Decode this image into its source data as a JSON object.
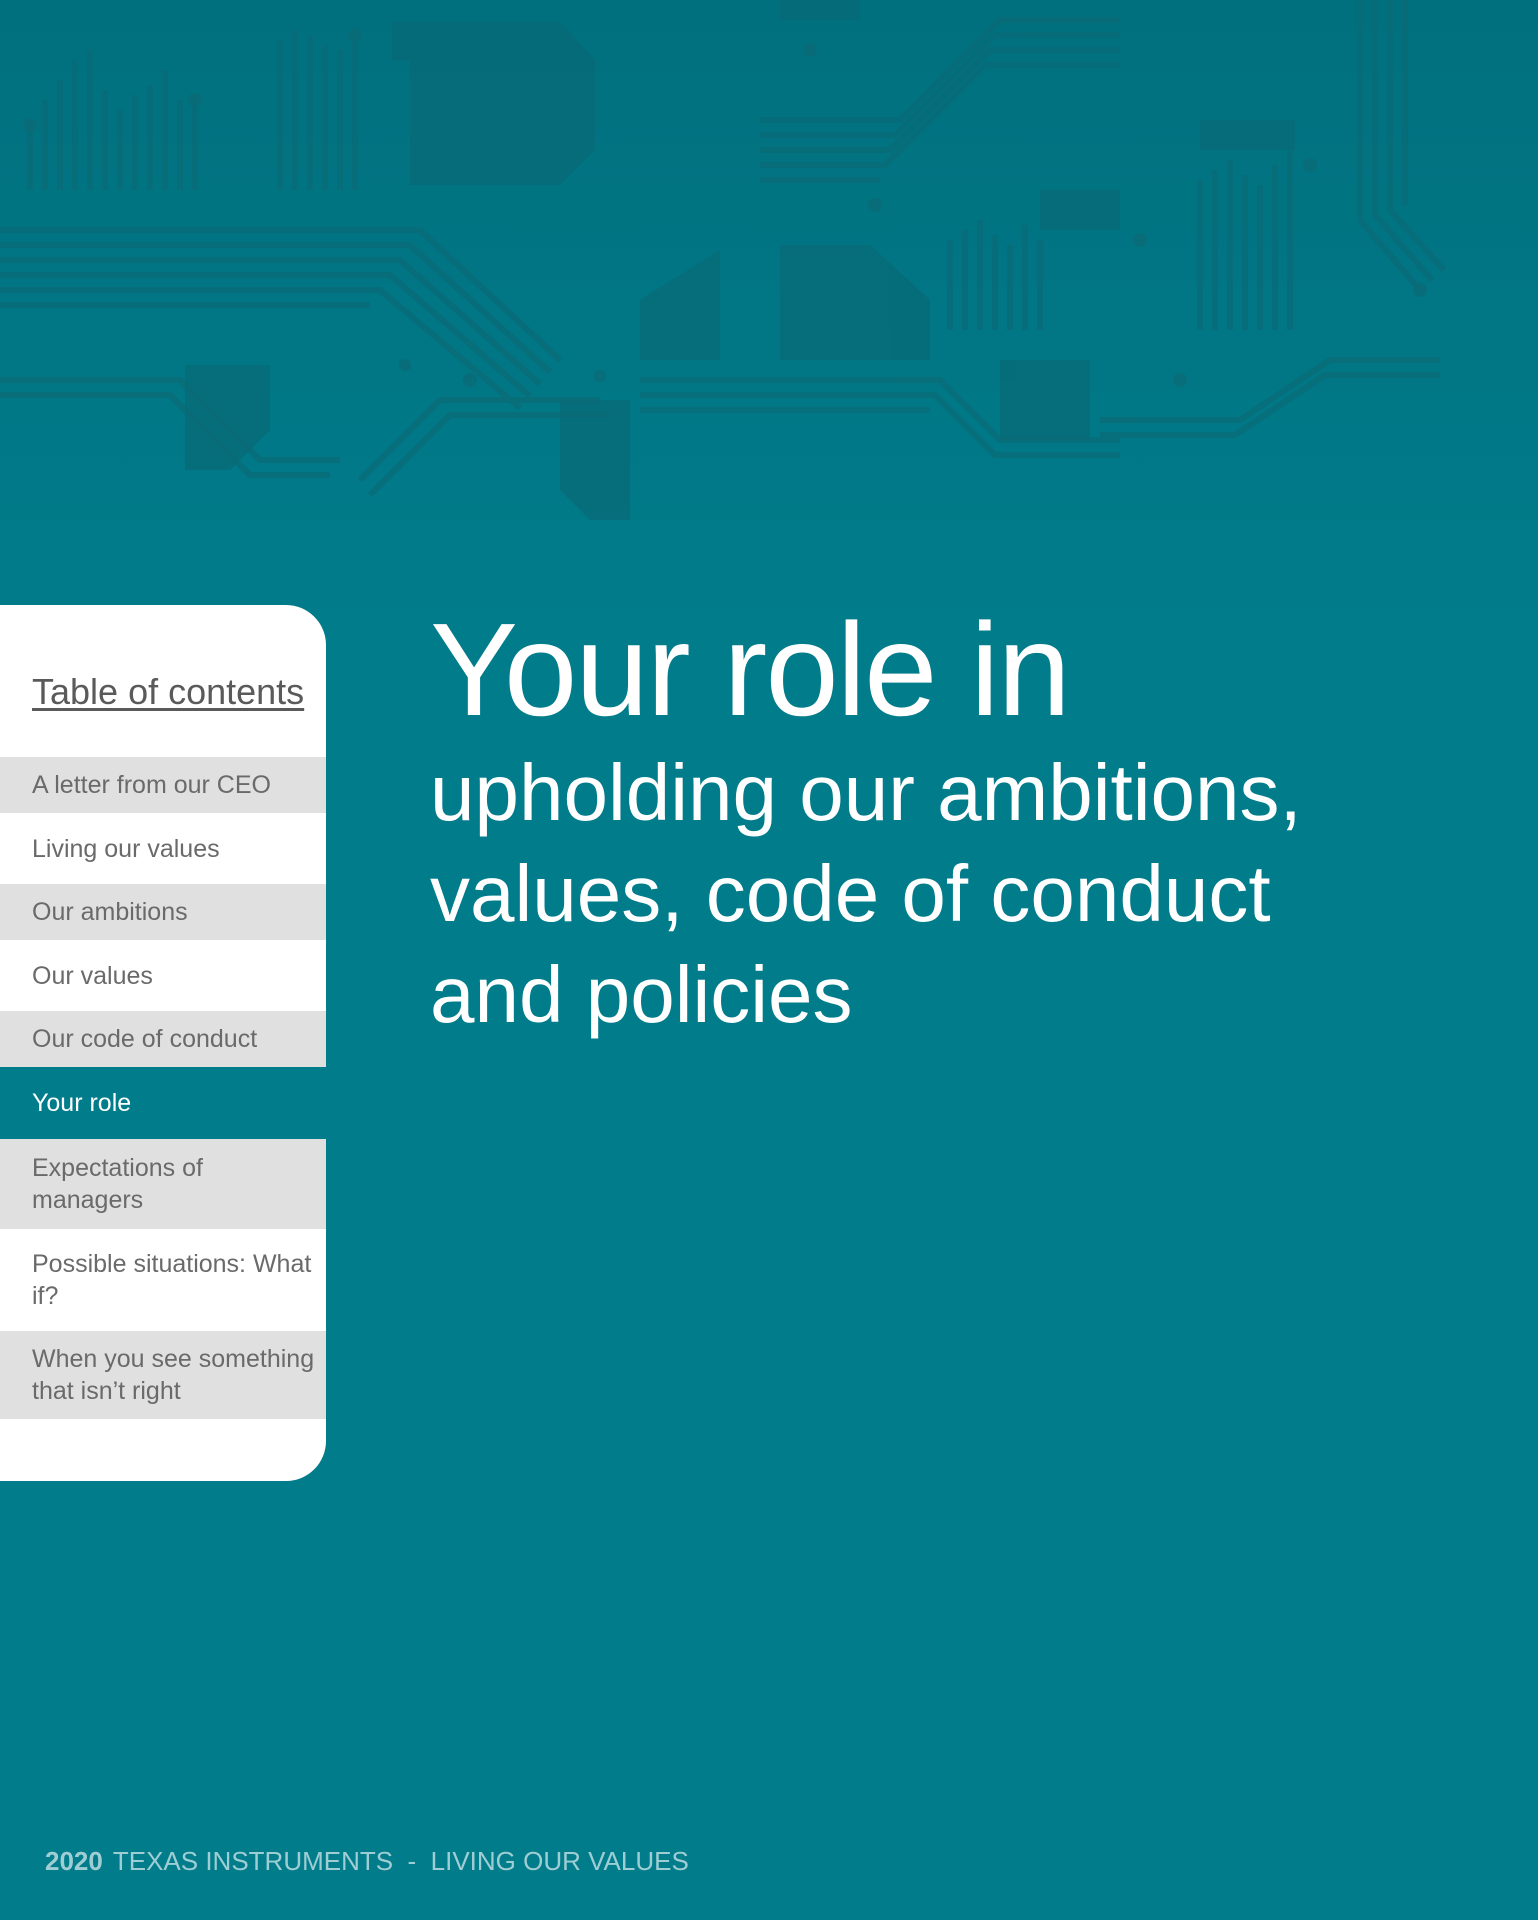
{
  "colors": {
    "background": "#017c8b",
    "toc_grey": "#e0e0e0",
    "toc_active": "#017c8b",
    "text_white": "#ffffff",
    "toc_text": "#6a6a6a"
  },
  "toc": {
    "title": "Table of contents",
    "items": [
      {
        "label": "A letter from our CEO",
        "state": "grey"
      },
      {
        "label": "Living our values",
        "state": "white"
      },
      {
        "label": "Our ambitions",
        "state": "grey"
      },
      {
        "label": "Our values",
        "state": "white"
      },
      {
        "label": "Our code of conduct",
        "state": "grey"
      },
      {
        "label": "Your role",
        "state": "active"
      },
      {
        "label": "Expectations of managers",
        "state": "grey"
      },
      {
        "label": "Possible situations: What if?",
        "state": "white"
      },
      {
        "label": "When you see something that isn’t right",
        "state": "grey"
      }
    ]
  },
  "headline": {
    "line1": "Your role in",
    "line2": "upholding our ambitions, values, code of conduct and policies"
  },
  "footer": {
    "year": "2020",
    "text": "TEXAS INSTRUMENTS  -  LIVING OUR VALUES"
  }
}
